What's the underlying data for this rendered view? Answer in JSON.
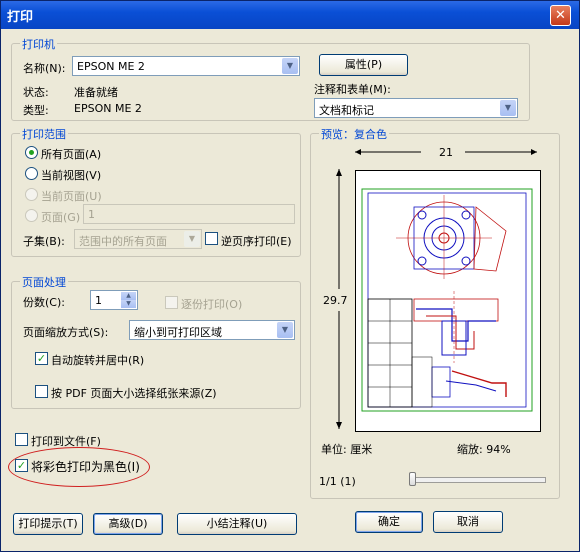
{
  "window": {
    "title": "打印",
    "close_glyph": "✕"
  },
  "printer": {
    "group_title": "打印机",
    "name_label": "名称(N):",
    "name_value": "EPSON ME 2",
    "properties_button": "属性(P)",
    "status_label": "状态:",
    "status_value": "准备就绪",
    "type_label": "类型:",
    "type_value": "EPSON ME 2",
    "comments_label": "注释和表单(M):",
    "comments_value": "文档和标记"
  },
  "range": {
    "group_title": "打印范围",
    "all_pages": "所有页面(A)",
    "current_view": "当前视图(V)",
    "current_page": "当前页面(U)",
    "pages_label": "页面(G)",
    "pages_value": "1",
    "subset_label": "子集(B):",
    "subset_value": "范围中的所有页面",
    "reverse_label": "逆页序打印(E)"
  },
  "handling": {
    "group_title": "页面处理",
    "copies_label": "份数(C):",
    "copies_value": "1",
    "collate_label": "逐份打印(O)",
    "scaling_label": "页面缩放方式(S):",
    "scaling_value": "缩小到可打印区域",
    "autorotate_label": "自动旋转并居中(R)",
    "pdf_page_size_label": "按 PDF 页面大小选择纸张来源(Z)"
  },
  "options": {
    "print_to_file": "打印到文件(F)",
    "color_as_black": "将彩色打印为黑色(I)"
  },
  "preview": {
    "title": "预览：复合色",
    "width": "21",
    "height": "29.7",
    "unit_label": "单位: 厘米",
    "zoom_label": "缩放: 94%",
    "page_indicator": "1/1 (1)"
  },
  "buttons": {
    "tips": "打印提示(T)",
    "advanced": "高级(D)",
    "summarize": "小结注释(U)",
    "ok": "确定",
    "cancel": "取消"
  },
  "colors": {
    "accent": "#0046d5",
    "annotation": "#d02020"
  }
}
